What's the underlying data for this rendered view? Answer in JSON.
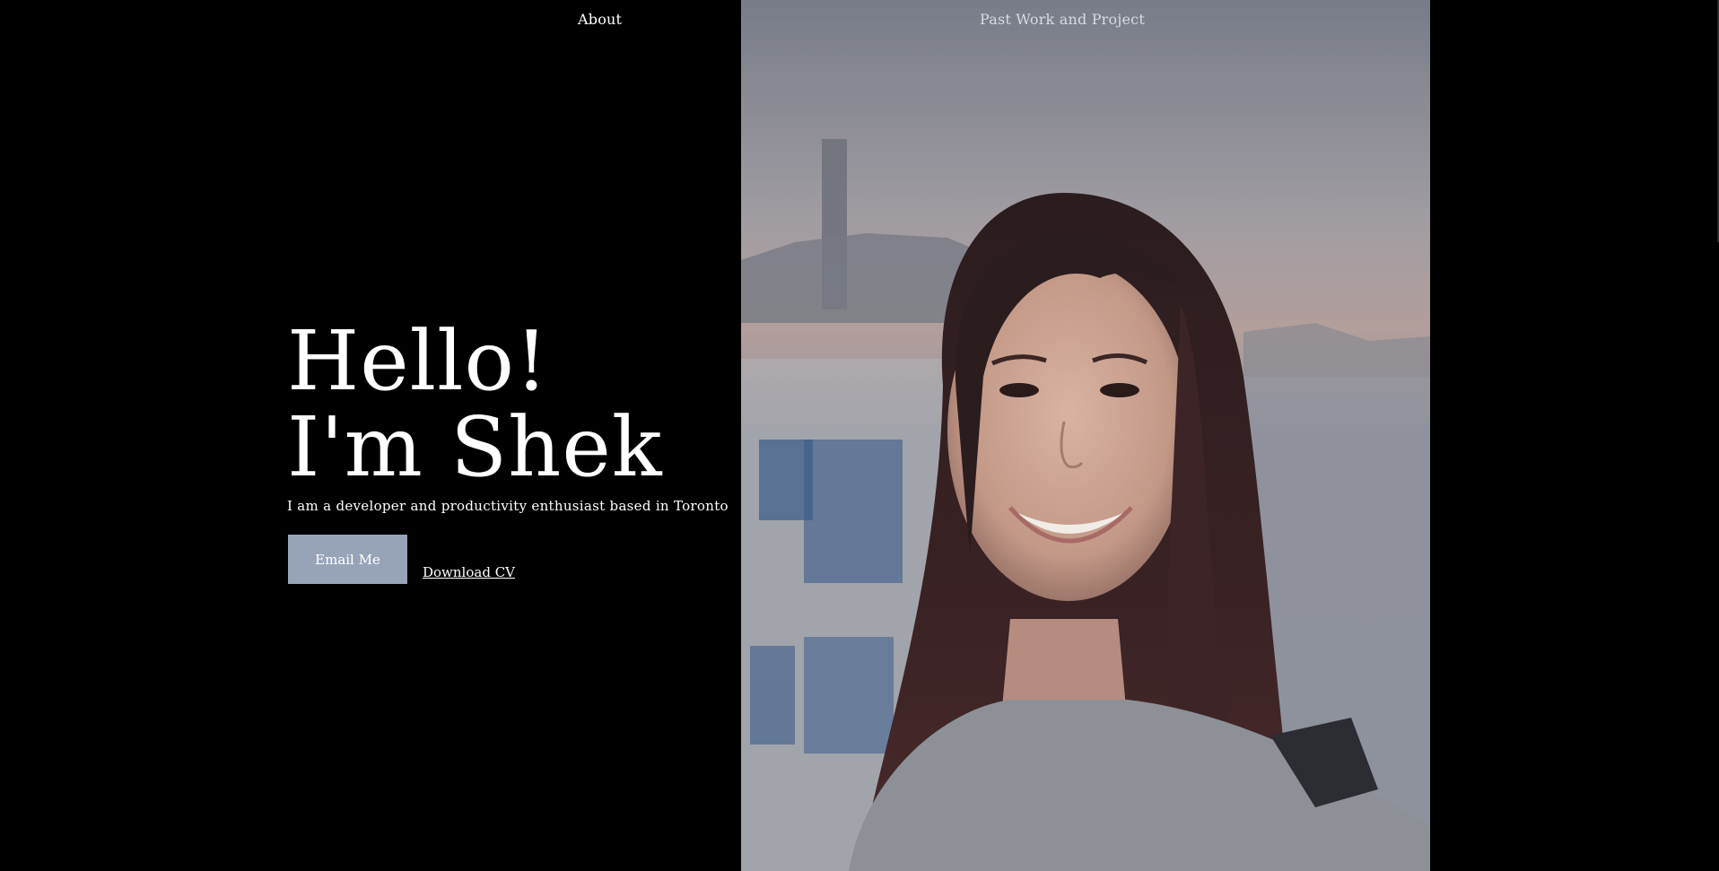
{
  "nav": {
    "about_label": "About",
    "work_label": "Past Work and Project"
  },
  "hero": {
    "line1": "Hello!",
    "line2": "I'm Shek",
    "subtitle": "I am a developer and productivity enthusiast based in Toronto",
    "email_button": "Email Me",
    "cv_link": "Download CV"
  },
  "colors": {
    "background": "#000000",
    "button": "#97a4b8",
    "text": "#ffffff"
  }
}
